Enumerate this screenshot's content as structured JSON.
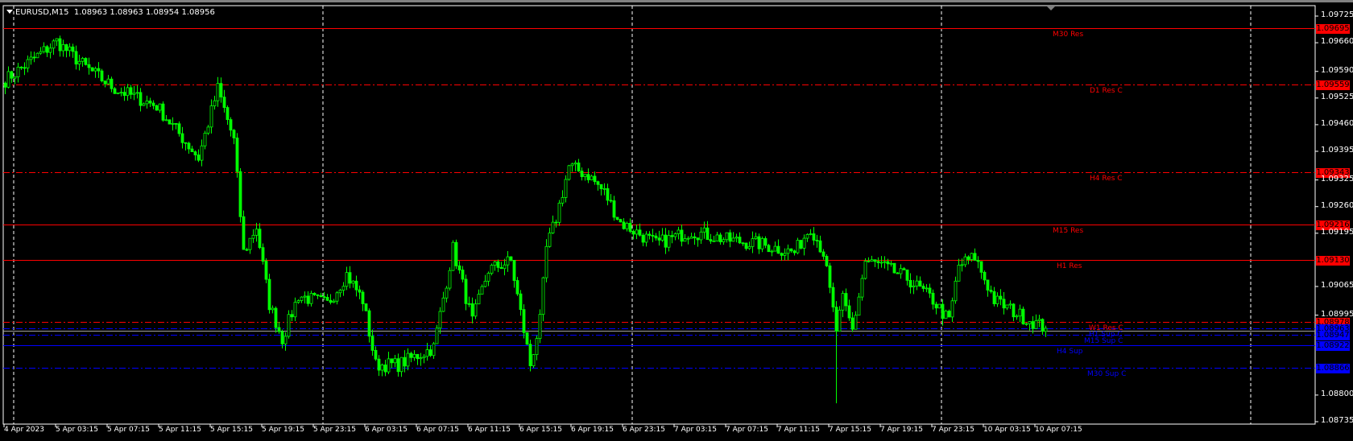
{
  "header": {
    "symbol": "EURUSD,M15",
    "open": "1.08963",
    "high": "1.08963",
    "low": "1.08954",
    "close": "1.08956"
  },
  "colors": {
    "background": "#000000",
    "candle": "#00ff00",
    "resistance": "#ff0000",
    "support": "#0000ff",
    "bid_line": "#a0a0a0",
    "grid": "#ffffff"
  },
  "price_axis": {
    "max": 1.09725,
    "min": 1.08735,
    "ticks": [
      "1.09725",
      "1.09660",
      "1.09590",
      "1.09525",
      "1.09460",
      "1.09395",
      "1.09325",
      "1.09260",
      "1.09195",
      "1.09065",
      "1.08995",
      "1.08800",
      "1.08735"
    ]
  },
  "time_axis": {
    "labels": [
      "4 Apr 2023",
      "5 Apr 03:15",
      "5 Apr 07:15",
      "5 Apr 11:15",
      "5 Apr 15:15",
      "5 Apr 19:15",
      "5 Apr 23:15",
      "6 Apr 03:15",
      "6 Apr 07:15",
      "6 Apr 11:15",
      "6 Apr 15:15",
      "6 Apr 19:15",
      "6 Apr 23:15",
      "7 Apr 03:15",
      "7 Apr 07:15",
      "7 Apr 11:15",
      "7 Apr 15:15",
      "7 Apr 19:15",
      "7 Apr 23:15",
      "10 Apr 03:15",
      "10 Apr 07:15"
    ]
  },
  "levels": [
    {
      "name": "M30 Res",
      "price": "1.09695",
      "type": "res",
      "style": "solid"
    },
    {
      "name": "D1 Res C",
      "price": "1.09559",
      "type": "res",
      "style": "dashdot"
    },
    {
      "name": "H4 Res C",
      "price": "1.09343",
      "type": "res",
      "style": "dashdot"
    },
    {
      "name": "M15 Res",
      "price": "1.09216",
      "type": "res",
      "style": "solid"
    },
    {
      "name": "H1 Res",
      "price": "1.09130",
      "type": "res",
      "style": "solid"
    },
    {
      "name": "W1 Res C",
      "price": "1.08978",
      "type": "res",
      "style": "dashdot"
    },
    {
      "name": "H1 Sup C",
      "price": "1.08963",
      "type": "sup",
      "style": "dashdot"
    },
    {
      "name": "M15 Sup C",
      "price": "1.08947",
      "type": "sup",
      "style": "dashdot"
    },
    {
      "name": "H4 Sup",
      "price": "1.08922",
      "type": "sup",
      "style": "solid"
    },
    {
      "name": "M30 Sup C",
      "price": "1.08866",
      "type": "sup",
      "style": "dashdot"
    }
  ],
  "bid": "1.08956",
  "chart_data": {
    "type": "candlestick",
    "timeframe": "M15",
    "price_path": [
      [
        0,
        1.09569
      ],
      [
        16,
        1.09663
      ],
      [
        25,
        1.096
      ],
      [
        34,
        1.09548
      ],
      [
        47,
        1.09506
      ],
      [
        60,
        1.09379
      ],
      [
        66,
        1.09548
      ],
      [
        71,
        1.09421
      ],
      [
        74,
        1.09148
      ],
      [
        78,
        1.09211
      ],
      [
        82,
        1.09022
      ],
      [
        86,
        1.08937
      ],
      [
        91,
        1.09043
      ],
      [
        100,
        1.09022
      ],
      [
        106,
        1.09095
      ],
      [
        111,
        1.09032
      ],
      [
        115,
        1.08874
      ],
      [
        122,
        1.08874
      ],
      [
        133,
        1.08916
      ],
      [
        139,
        1.09158
      ],
      [
        145,
        1.0898
      ],
      [
        150,
        1.09106
      ],
      [
        157,
        1.09127
      ],
      [
        163,
        1.08874
      ],
      [
        166,
        1.0898
      ],
      [
        168,
        1.09158
      ],
      [
        171,
        1.09232
      ],
      [
        175,
        1.09358
      ],
      [
        181,
        1.09337
      ],
      [
        186,
        1.09295
      ],
      [
        191,
        1.09221
      ],
      [
        202,
        1.09169
      ],
      [
        213,
        1.092
      ],
      [
        224,
        1.09179
      ],
      [
        234,
        1.09169
      ],
      [
        245,
        1.09148
      ],
      [
        250,
        1.09211
      ],
      [
        254,
        1.09148
      ],
      [
        258,
        1.08958
      ],
      [
        260,
        1.09032
      ],
      [
        263,
        1.08958
      ],
      [
        267,
        1.09127
      ],
      [
        272,
        1.09116
      ],
      [
        280,
        1.09085
      ],
      [
        288,
        1.09032
      ],
      [
        293,
        1.0898
      ],
      [
        296,
        1.09116
      ],
      [
        301,
        1.09137
      ],
      [
        307,
        1.09032
      ],
      [
        315,
        1.08995
      ],
      [
        323,
        1.08963
      ]
    ],
    "spike_low": [
      258,
      1.0878
    ]
  }
}
